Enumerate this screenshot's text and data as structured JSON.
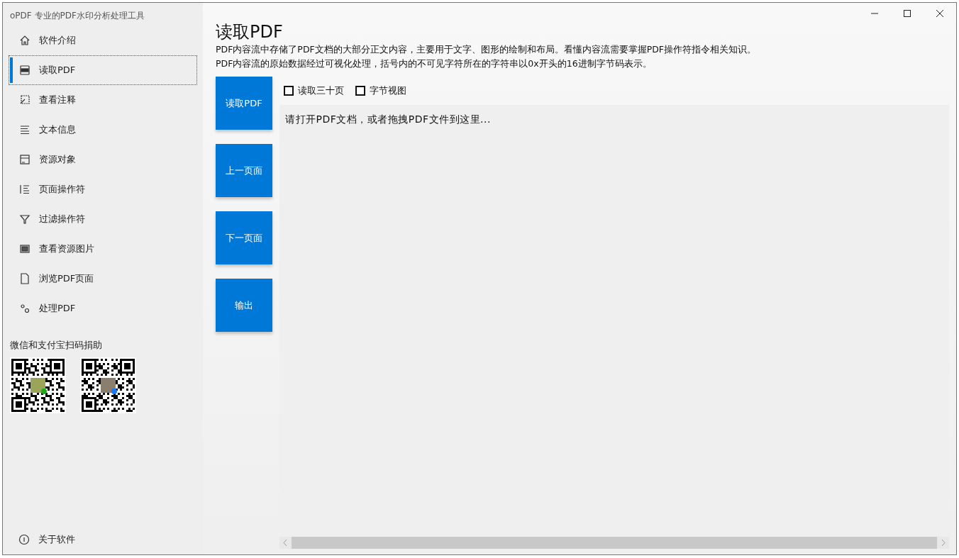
{
  "window": {
    "title": "oPDF 专业的PDF水印分析处理工具"
  },
  "sidebar": {
    "items": [
      {
        "label": "软件介绍",
        "kind": "home",
        "selected": false
      },
      {
        "label": "读取PDF",
        "kind": "pdf",
        "selected": true
      },
      {
        "label": "查看注释",
        "kind": "annotate",
        "selected": false
      },
      {
        "label": "文本信息",
        "kind": "lines",
        "selected": false
      },
      {
        "label": "资源对象",
        "kind": "archive",
        "selected": false
      },
      {
        "label": "页面操作符",
        "kind": "list",
        "selected": false
      },
      {
        "label": "过滤操作符",
        "kind": "filter",
        "selected": false
      },
      {
        "label": "查看资源图片",
        "kind": "image",
        "selected": false
      },
      {
        "label": "浏览PDF页面",
        "kind": "page",
        "selected": false
      },
      {
        "label": "处理PDF",
        "kind": "gears",
        "selected": false
      }
    ],
    "donate_label": "微信和支付宝扫码捐助",
    "qr_codes": [
      {
        "kind": "wechat"
      },
      {
        "kind": "alipay"
      }
    ],
    "footer_item": {
      "label": "关于软件",
      "kind": "info"
    }
  },
  "main": {
    "title": "读取PDF",
    "description": [
      "PDF内容流中存储了PDF文档的大部分正文内容，主要用于文字、图形的绘制和布局。看懂内容流需要掌握PDF操作符指令相关知识。",
      "PDF内容流的原始数据经过可视化处理，括号内的不可见字符所在的字符串以0x开头的16进制字节码表示。"
    ],
    "buttons": [
      "读取PDF",
      "上一页面",
      "下一页面",
      "输出"
    ],
    "options": [
      {
        "label": "读取三十页",
        "checked": false
      },
      {
        "label": "字节视图",
        "checked": false
      }
    ],
    "content": "请打开PDF文档，或者拖拽PDF文件到这里..."
  }
}
